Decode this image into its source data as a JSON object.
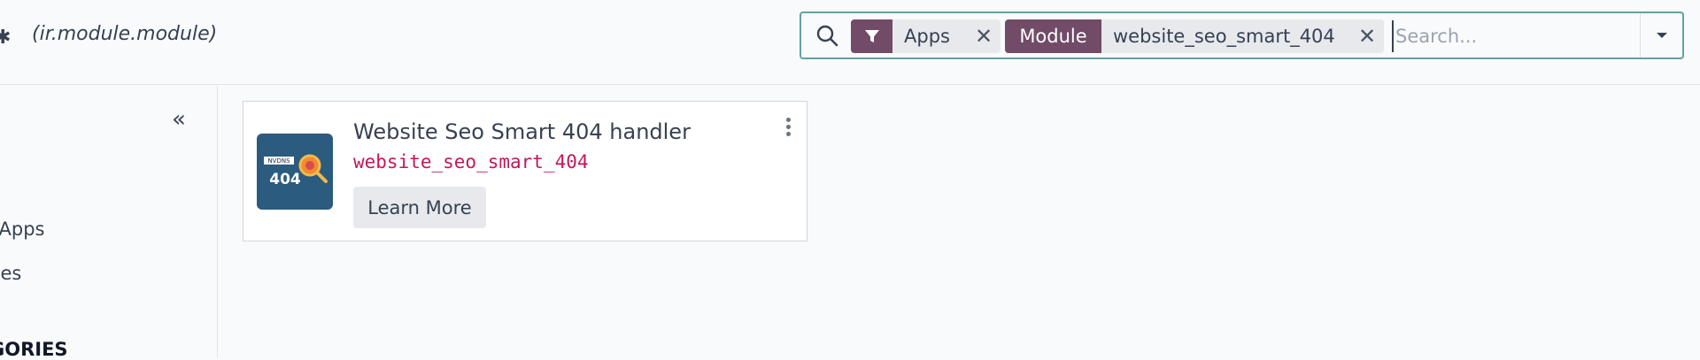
{
  "header": {
    "model": "(ir.module.module)"
  },
  "search": {
    "facets": [
      {
        "label_icon": "filter-icon",
        "value": "Apps"
      },
      {
        "label": "Module",
        "value": "website_seo_smart_404"
      }
    ],
    "placeholder": "Search..."
  },
  "sidebar": {
    "items": [
      {
        "label": "l Apps"
      },
      {
        "label": "ries"
      }
    ],
    "heading": "GORIES"
  },
  "card": {
    "name": "Website Seo Smart 404 handler",
    "technical_name": "website_seo_smart_404",
    "button": "Learn More",
    "icon_text_top": "NVDNS",
    "icon_text_main": "404"
  },
  "colors": {
    "accent": "#714b67",
    "search_border": "#5fa2a3",
    "technical_name": "#c2185b",
    "icon_bg": "#2b5b7e"
  }
}
